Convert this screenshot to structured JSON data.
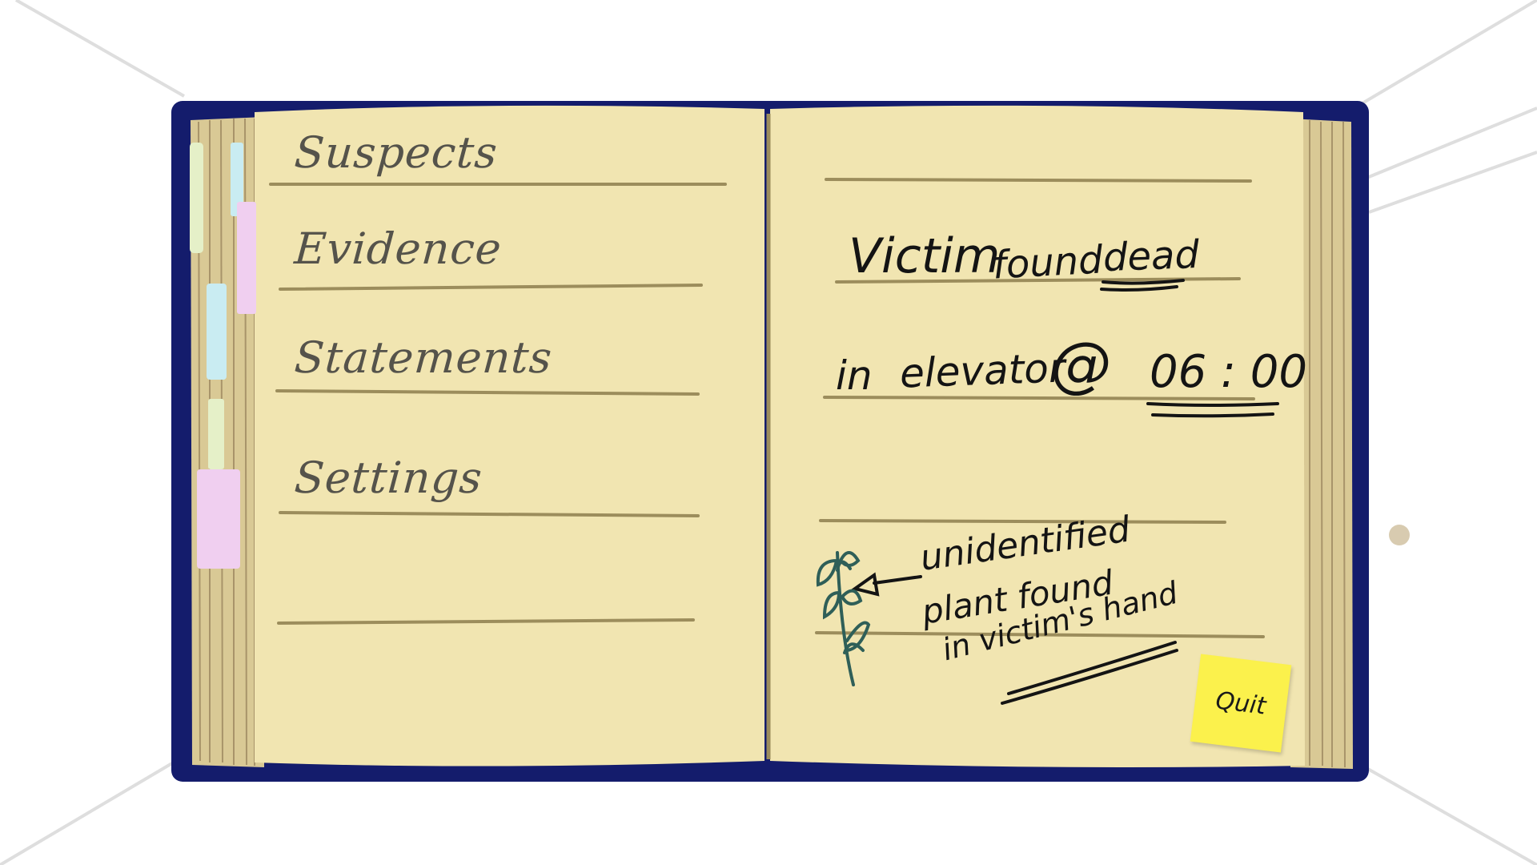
{
  "menu": {
    "items": [
      {
        "label": "Suspects"
      },
      {
        "label": "Evidence"
      },
      {
        "label": "Statements"
      },
      {
        "label": "Settings"
      }
    ]
  },
  "notes": {
    "line1_a": "Victim",
    "line1_b": "found",
    "line1_c": "dead",
    "line2_a": "in",
    "line2_b": "elevator",
    "line2_c": "@",
    "line2_time": "06 : 00",
    "plant_note_1": "unidentified",
    "plant_note_2": "plant found",
    "plant_note_3": "in victim's hand"
  },
  "quit": {
    "label": "Quit"
  },
  "colors": {
    "cover": "#141c6c",
    "page": "#f1e5b1",
    "rule": "#9c8d5c",
    "sticky": "#fbf14c",
    "tab_blue": "#c9ecf2",
    "tab_pink": "#f0cff0",
    "tab_green": "#e5f0c8"
  }
}
